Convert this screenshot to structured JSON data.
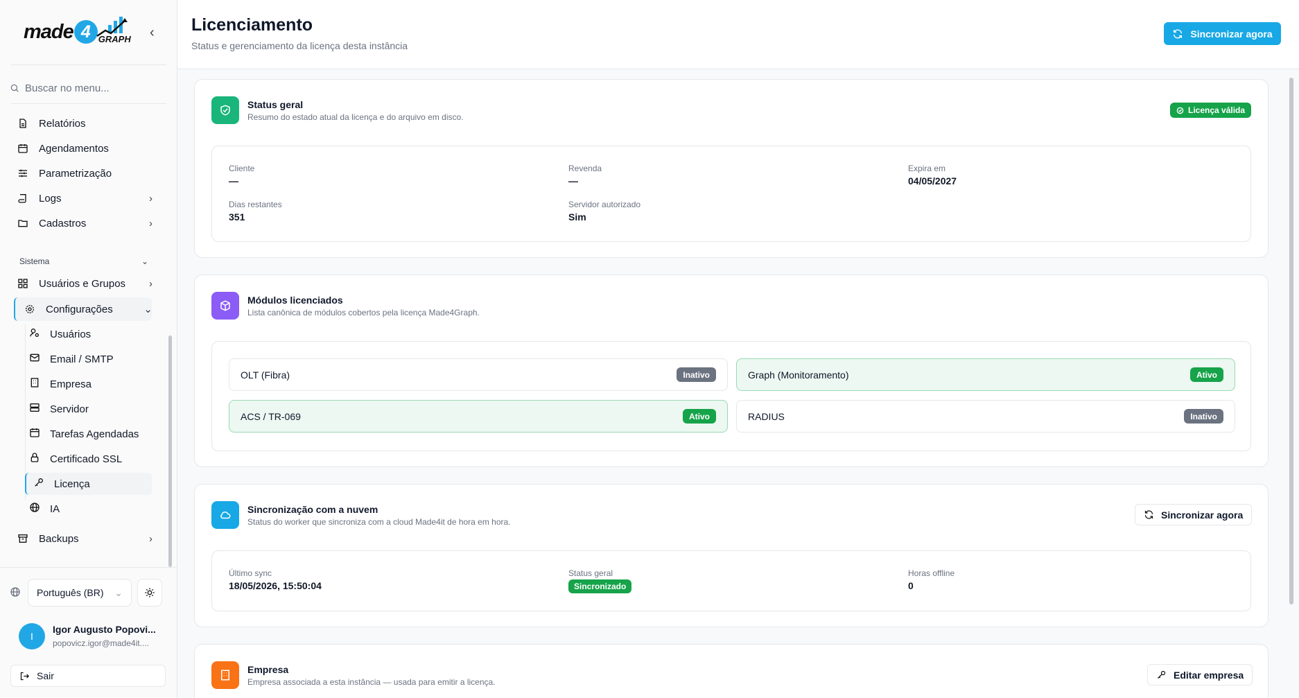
{
  "brand": {
    "made": "made",
    "four": "4",
    "graph": "GRAPH"
  },
  "search": {
    "placeholder": "Buscar no menu..."
  },
  "nav": {
    "items": [
      "Relatórios",
      "Agendamentos",
      "Parametrização",
      "Logs",
      "Cadastros"
    ],
    "section": "Sistema",
    "users_groups": "Usuários e Grupos",
    "config": "Configurações",
    "sub": [
      "Usuários",
      "Email / SMTP",
      "Empresa",
      "Servidor",
      "Tarefas Agendadas",
      "Certificado SSL",
      "Licença",
      "IA"
    ],
    "backups": "Backups"
  },
  "footer": {
    "language": "Português (BR)",
    "user_initial": "I",
    "user_name": "Igor Augusto Popovi...",
    "user_email": "popovicz.igor@made4it....",
    "logout": "Sair"
  },
  "header": {
    "title": "Licenciamento",
    "subtitle": "Status e gerenciamento da licença desta instância",
    "sync_button": "Sincronizar agora"
  },
  "status": {
    "title": "Status geral",
    "subtitle": "Resumo do estado atual da licença e do arquivo em disco.",
    "badge": "Licença válida",
    "fields": [
      {
        "label": "Cliente",
        "value": "—"
      },
      {
        "label": "Revenda",
        "value": "—"
      },
      {
        "label": "Expira em",
        "value": "04/05/2027"
      },
      {
        "label": "Dias restantes",
        "value": "351"
      },
      {
        "label": "Servidor autorizado",
        "value": "Sim"
      }
    ]
  },
  "modules": {
    "title": "Módulos licenciados",
    "subtitle": "Lista canônica de módulos cobertos pela licença Made4Graph.",
    "items": [
      {
        "name": "OLT (Fibra)",
        "status": "Inativo",
        "active": false
      },
      {
        "name": "Graph (Monitoramento)",
        "status": "Ativo",
        "active": true
      },
      {
        "name": "ACS / TR-069",
        "status": "Ativo",
        "active": true
      },
      {
        "name": "RADIUS",
        "status": "Inativo",
        "active": false
      }
    ]
  },
  "sync": {
    "title": "Sincronização com a nuvem",
    "subtitle": "Status do worker que sincroniza com a cloud Made4it de hora em hora.",
    "button": "Sincronizar agora",
    "last_sync_label": "Último sync",
    "last_sync_value": "18/05/2026, 15:50:04",
    "status_label": "Status geral",
    "status_value": "Sincronizado",
    "offline_label": "Horas offline",
    "offline_value": "0"
  },
  "company": {
    "title": "Empresa",
    "subtitle": "Empresa associada a esta instância — usada para emitir a licença.",
    "button": "Editar empresa"
  },
  "colors": {
    "accent": "#17a8e5",
    "success": "#16a34a",
    "inactive": "#6b7280",
    "purple": "#8b5cf6",
    "orange": "#f97316"
  }
}
